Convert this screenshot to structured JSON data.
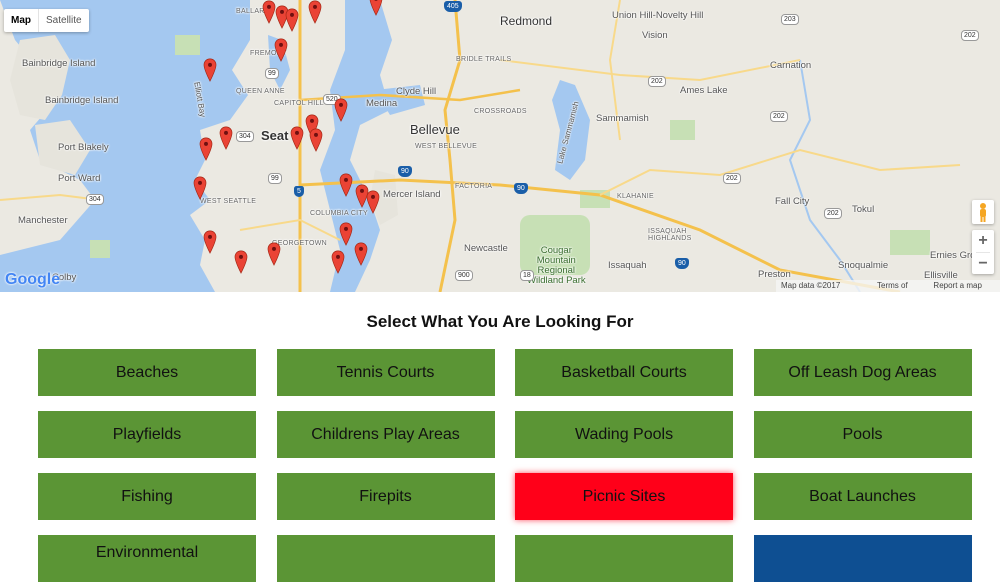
{
  "map": {
    "type_controls": {
      "map": "Map",
      "satellite": "Satellite"
    },
    "zoom": {
      "in": "+",
      "out": "−"
    },
    "logo": "Google",
    "attribution": {
      "data": "Map data ©2017 Google",
      "terms": "Terms of Use",
      "report": "Report a map error"
    },
    "labels": {
      "redmond": "Redmond",
      "union_hill": "Union Hill-Novelty Hill",
      "bainbridge_island_1": "Bainbridge Island",
      "bainbridge_island_2": "Bainbridge Island",
      "port_blakely": "Port Blakely",
      "port_ward": "Port Ward",
      "manchester": "Manchester",
      "colby": "Colby",
      "ballard": "BALLARD",
      "fremont": "FREMONT",
      "queen_anne": "QUEEN ANNE",
      "capitol_hill": "CAPITOL HILL",
      "seattle": "Seat",
      "elliott_bay": "Elliott Bay",
      "west_seattle": "WEST SEATTLE",
      "columbia_city": "COLUMBIA CITY",
      "georgetown": "GEORGETOWN",
      "bridle_trails": "BRIDLE TRAILS",
      "clyde_hill": "Clyde Hill",
      "medina": "Medina",
      "crossroads": "CROSSROADS",
      "bellevue": "Bellevue",
      "west_bellevue": "WEST BELLEVUE",
      "mercer_island": "Mercer Island",
      "factoria": "FACTORIA",
      "newcastle": "Newcastle",
      "cougar_mountain": "Cougar\nMountain\nRegional\nWildland Park",
      "issaquah": "Issaquah",
      "issaquah_highlands": "ISSAQUAH\nHIGHLANDS",
      "klahanie": "KLAHANIE",
      "sammamish": "Sammamish",
      "lake_sammamish": "Lake Sammamish",
      "ames_lake": "Ames Lake",
      "carnation": "Carnation",
      "fall_city": "Fall City",
      "tokul": "Tokul",
      "snoqualmie": "Snoqualmie",
      "ernies_grove": "Ernies Grov",
      "ellisville": "Ellisville",
      "preston": "Preston",
      "vision": "Vision"
    },
    "shields": [
      "405",
      "520",
      "90",
      "90",
      "5",
      "99",
      "99",
      "304",
      "304",
      "202",
      "202",
      "202",
      "202",
      "202",
      "900",
      "18",
      "203",
      "90"
    ]
  },
  "heading": "Select What You Are Looking For",
  "categories": [
    {
      "label": "Beaches"
    },
    {
      "label": "Tennis Courts"
    },
    {
      "label": "Basketball Courts"
    },
    {
      "label": "Off Leash Dog Areas"
    },
    {
      "label": "Playfields"
    },
    {
      "label": "Childrens Play Areas"
    },
    {
      "label": "Wading Pools"
    },
    {
      "label": "Pools"
    },
    {
      "label": "Fishing"
    },
    {
      "label": "Firepits"
    },
    {
      "label": "Picnic Sites",
      "active": true
    },
    {
      "label": "Boat Launches"
    },
    {
      "label": "Environmental"
    },
    {
      "label": ""
    },
    {
      "label": ""
    },
    {
      "label": ""
    }
  ],
  "colors": {
    "button_green": "#5b9535",
    "button_active": "#ff0019",
    "button_blue": "#0e4f92",
    "water": "#a4c8f0"
  }
}
